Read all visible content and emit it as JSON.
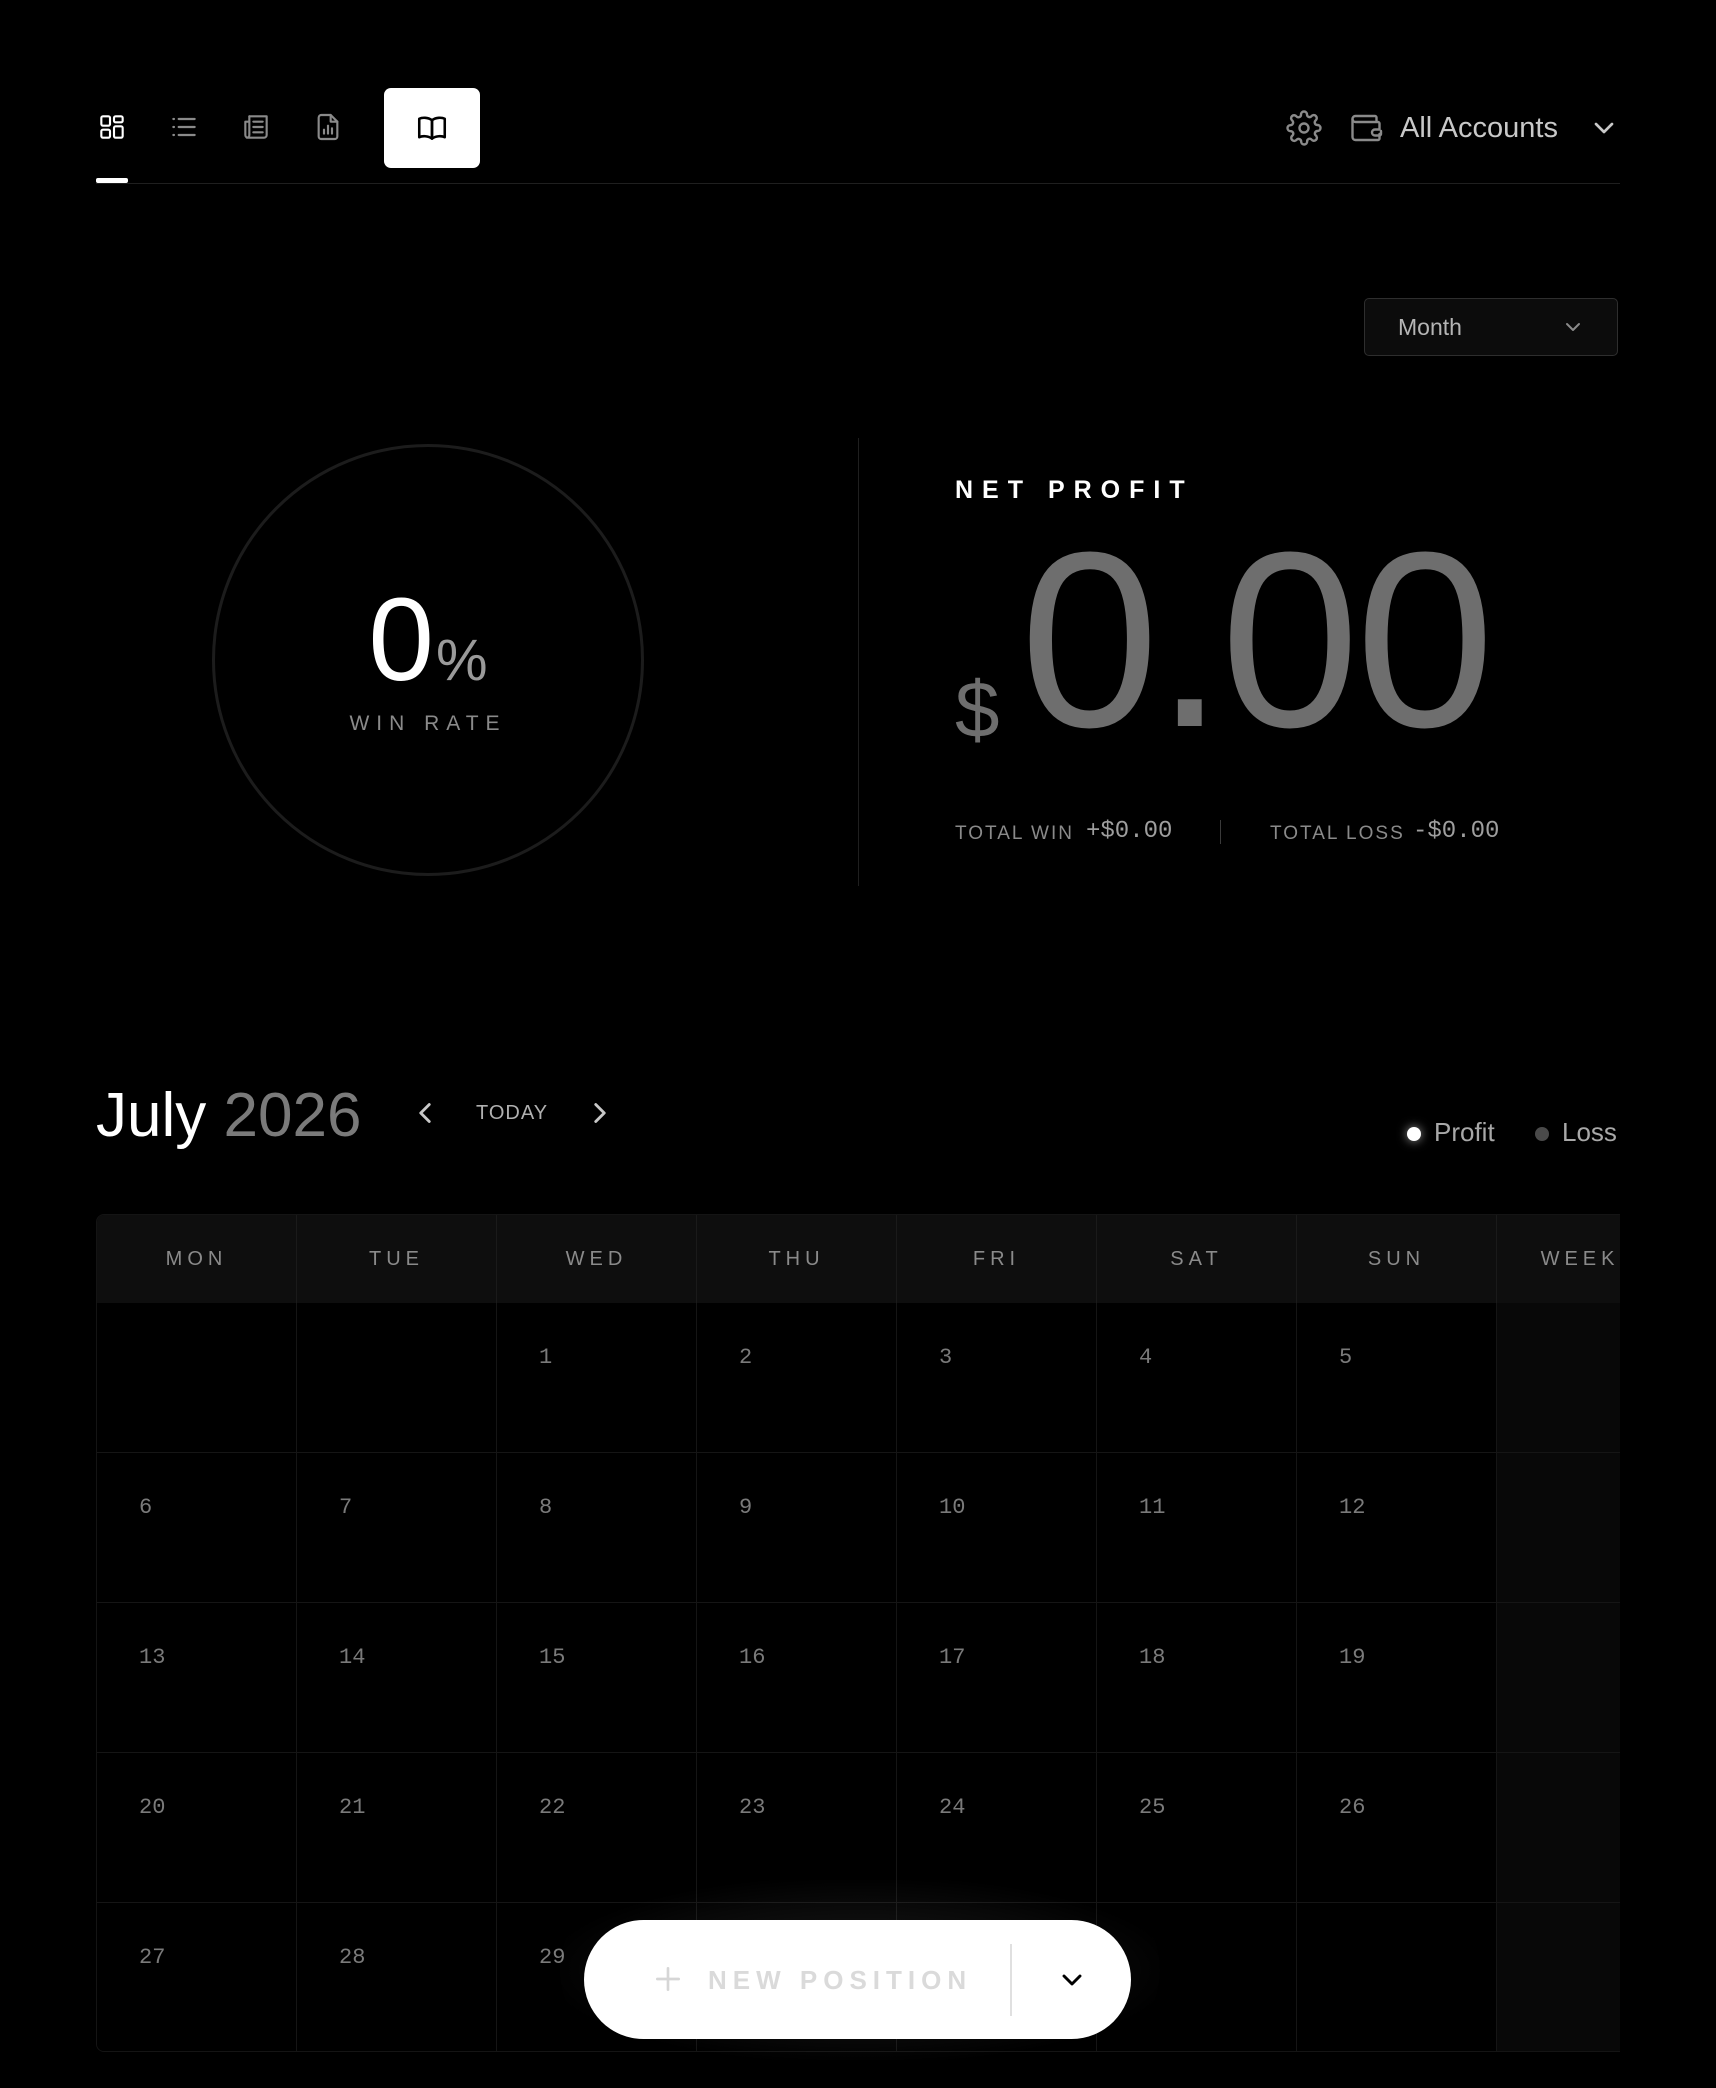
{
  "nav": {
    "icons": [
      "dashboard-icon",
      "list-icon",
      "news-icon",
      "report-icon",
      "journal-book-icon"
    ],
    "active": "dashboard",
    "settings_icon": "gear-icon",
    "wallet_icon": "wallet-icon",
    "account_select": "All Accounts"
  },
  "period": {
    "selected": "Month"
  },
  "win_rate": {
    "value": "0",
    "unit": "%",
    "label": "WIN RATE"
  },
  "net_profit": {
    "label": "NET PROFIT",
    "currency": "$",
    "amount": "0.00",
    "total_win_label": "TOTAL WIN",
    "total_win_value": "+$0.00",
    "total_loss_label": "TOTAL LOSS",
    "total_loss_value": "-$0.00"
  },
  "calendar": {
    "month": "July",
    "year": "2026",
    "today_label": "TODAY",
    "legend": {
      "profit": "Profit",
      "loss": "Loss"
    },
    "headers": [
      "MON",
      "TUE",
      "WED",
      "THU",
      "FRI",
      "SAT",
      "SUN",
      "WEEKLY"
    ],
    "weeks": [
      [
        "",
        "",
        "1",
        "2",
        "3",
        "4",
        "5"
      ],
      [
        "6",
        "7",
        "8",
        "9",
        "10",
        "11",
        "12"
      ],
      [
        "13",
        "14",
        "15",
        "16",
        "17",
        "18",
        "19"
      ],
      [
        "20",
        "21",
        "22",
        "23",
        "24",
        "25",
        "26"
      ],
      [
        "27",
        "28",
        "29",
        "",
        "",
        "",
        ""
      ]
    ]
  },
  "fab": {
    "label": "NEW POSITION"
  },
  "colors": {
    "background": "#000000",
    "accent": "#ffffff",
    "muted": "#6e6e6e"
  }
}
